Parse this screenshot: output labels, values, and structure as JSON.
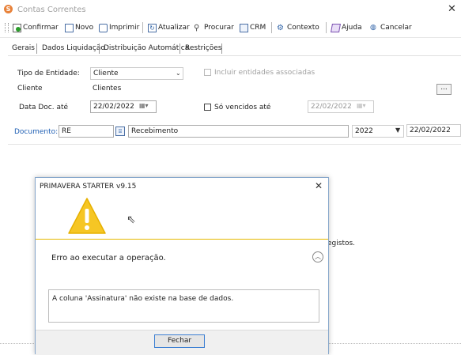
{
  "window": {
    "title": "Contas Correntes",
    "logo_letter": "S"
  },
  "toolbar": {
    "confirm": "Confirmar",
    "new": "Novo",
    "print": "Imprimir",
    "refresh": "Atualizar",
    "search": "Procurar",
    "crm": "CRM",
    "context": "Contexto",
    "help": "Ajuda",
    "cancel": "Cancelar"
  },
  "tabs": [
    "Gerais",
    "Dados Liquidação",
    "Distribuição Automática",
    "Restrições"
  ],
  "form": {
    "entity_type_label": "Tipo de Entidade:",
    "entity_type_value": "Cliente",
    "include_associated_label": "Incluir entidades associadas",
    "client_label": "Cliente",
    "client_value": "Clientes",
    "lookup_button": "...",
    "doc_date_label": "Data Doc. até",
    "doc_date_value": "22/02/2022",
    "only_due_label": "Só vencidos até",
    "only_due_value": "22/02/2022",
    "document_label": "Documento:",
    "document_code": "RE",
    "document_name": "Recebimento",
    "year": "2022",
    "document_date": "22/02/2022"
  },
  "background_text": "egistos.",
  "dialog": {
    "title": "PRIMAVERA STARTER v9.15",
    "message": "Erro ao executar a operação.",
    "detail": "A coluna 'Assinatura' não existe na base de dados.",
    "close_button": "Fechar"
  },
  "colors": {
    "accent_blue": "#1f5fb4",
    "warning_yellow": "#f6c624",
    "logo_orange": "#e8823a"
  }
}
